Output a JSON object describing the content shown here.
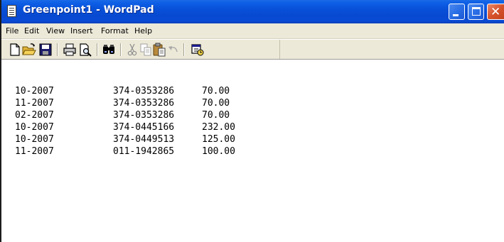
{
  "window": {
    "title": "Greenpoint1 - WordPad",
    "icon": "wordpad-document-icon",
    "controls": [
      "minimize-icon",
      "maximize-icon",
      "close-icon"
    ]
  },
  "menubar": {
    "items": [
      "File",
      "Edit",
      "View",
      "Insert",
      "Format",
      "Help"
    ]
  },
  "toolbar": {
    "buttons": [
      "new-icon",
      "open-icon",
      "save-icon",
      "print-icon",
      "print-preview-icon",
      "find-icon",
      "cut-icon",
      "copy-icon",
      "paste-icon",
      "undo-icon",
      "date-time-icon"
    ]
  },
  "document": {
    "lines": [
      {
        "date": "10-2007",
        "account": "374-0353286",
        "amount": "70.00"
      },
      {
        "date": "11-2007",
        "account": "374-0353286",
        "amount": "70.00"
      },
      {
        "date": "02-2007",
        "account": "374-0353286",
        "amount": "70.00"
      },
      {
        "date": "10-2007",
        "account": "374-0445166",
        "amount": "232.00"
      },
      {
        "date": "10-2007",
        "account": "374-0449513",
        "amount": "125.00"
      },
      {
        "date": "11-2007",
        "account": "011-1942865",
        "amount": "100.00"
      }
    ]
  },
  "colors": {
    "titlebar": "#0a4bd6",
    "chrome": "#ece9d8",
    "close_button": "#d6512a"
  }
}
